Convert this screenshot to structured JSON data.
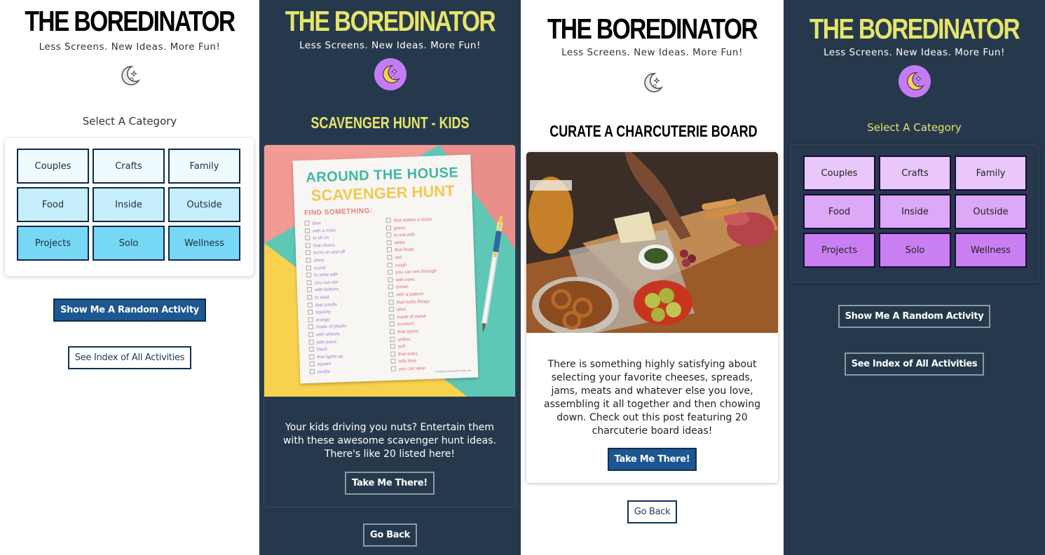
{
  "app": {
    "title": "THE BOREDINATOR",
    "tagline": "Less Screens. New Ideas. More Fun!"
  },
  "home": {
    "category_label": "Select A Category",
    "categories": [
      "Couples",
      "Crafts",
      "Family",
      "Food",
      "Inside",
      "Outside",
      "Projects",
      "Solo",
      "Wellness"
    ],
    "random_button": "Show Me A Random Activity",
    "index_button": "See Index of All Activities"
  },
  "activity_kids": {
    "title": "SCAVENGER HUNT - KIDS",
    "description": "Your kids driving you nuts? Entertain them with these awesome scavenger hunt ideas. There's like 20 listed here!",
    "cta": "Take Me There!",
    "back": "Go Back",
    "image": {
      "title_line1": "AROUND THE HOUSE",
      "title_line2": "SCAVENGER HUNT",
      "find": "FIND SOMETHING:",
      "left_items": [
        "blue",
        "with a nose",
        "to sit on",
        "that closes",
        "turns on and off",
        "shiny",
        "round",
        "to write with",
        "you can eat",
        "with buttons",
        "to read",
        "that smells",
        "squishy",
        "orange",
        "made of plastic",
        "with wheels",
        "with paws",
        "black",
        "that lights up",
        "square",
        "purple"
      ],
      "right_items": [
        "that makes a noise",
        "green",
        "to eat with",
        "white",
        "that floats",
        "red",
        "rough",
        "you can see through",
        "with eyes",
        "brown",
        "with a pattern",
        "that holds things",
        "alive",
        "made of metal",
        "crooked",
        "that opens",
        "yellow",
        "soft",
        "that sinks",
        "tells time",
        "you can wear"
      ],
      "copyright": "© happinessishomemade.net"
    }
  },
  "activity_charcuterie": {
    "title": "CURATE A CHARCUTERIE BOARD",
    "description": "There is something highly satisfying about selecting your favorite cheeses, spreads, jams, meats and whatever else you love, assembling it all together and then chowing down. Check out this post featuring 20 charcuterie board ideas!",
    "cta": "Take Me There!",
    "back": "Go Back"
  },
  "colors": {
    "dark_bg": "#26394c",
    "accent_yellow": "#e6e46a",
    "moon_purple": "#c57bf3",
    "primary_blue": "#1d5690",
    "light_cat_rows": [
      "#f0fbff",
      "#c6eefb",
      "#77d8f6"
    ],
    "dark_cat_rows": [
      "#eac7fb",
      "#dca8f7",
      "#c97ff2"
    ]
  },
  "icons": {
    "moon": "moon-stars-icon"
  }
}
